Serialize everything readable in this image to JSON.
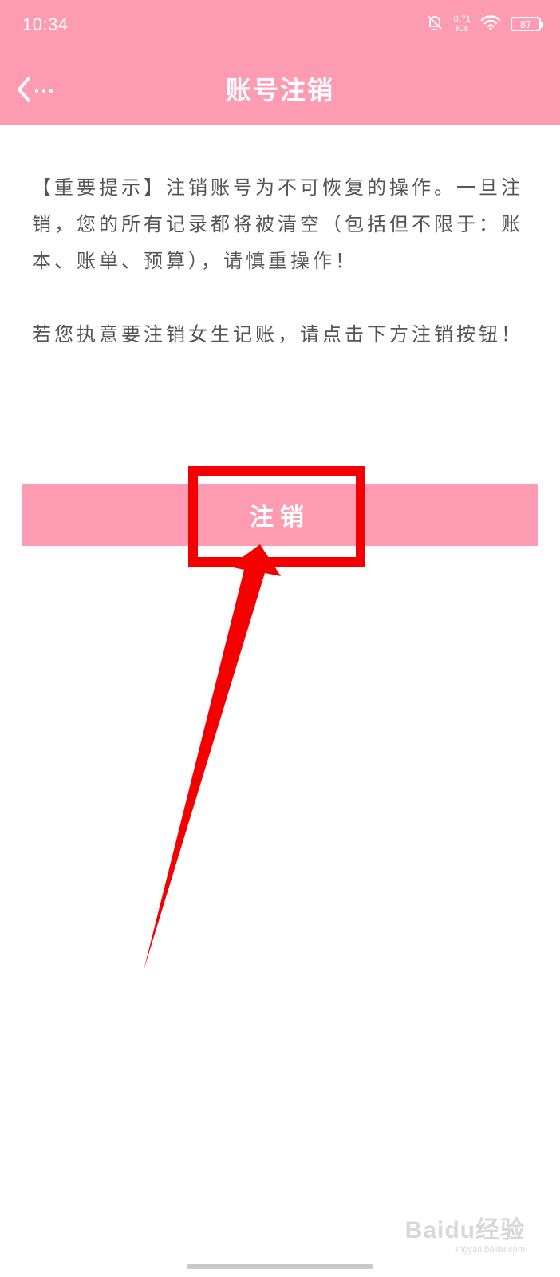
{
  "status_bar": {
    "time": "10:34",
    "net_speed_value": "0.71",
    "net_speed_unit": "K/s",
    "battery": "87",
    "mute_icon": "bell-off-icon",
    "wifi_icon": "wifi-icon"
  },
  "header": {
    "title": "账号注销",
    "back_icon": "chevron-left-icon",
    "background_color": "#fd9bb3"
  },
  "notice": {
    "paragraph1": "【重要提示】注销账号为不可恢复的操作。一旦注销，您的所有记录都将被清空（包括但不限于：账本、账单、预算），请慎重操作！",
    "paragraph2": "若您执意要注销女生记账，请点击下方注销按钮！"
  },
  "cancel_button": {
    "label": "注销",
    "color": "#fd9bb3"
  },
  "annotation": {
    "color": "#f40000"
  },
  "watermark": {
    "main": "Baidu经验",
    "sub": "jingyan.baidu.com"
  }
}
